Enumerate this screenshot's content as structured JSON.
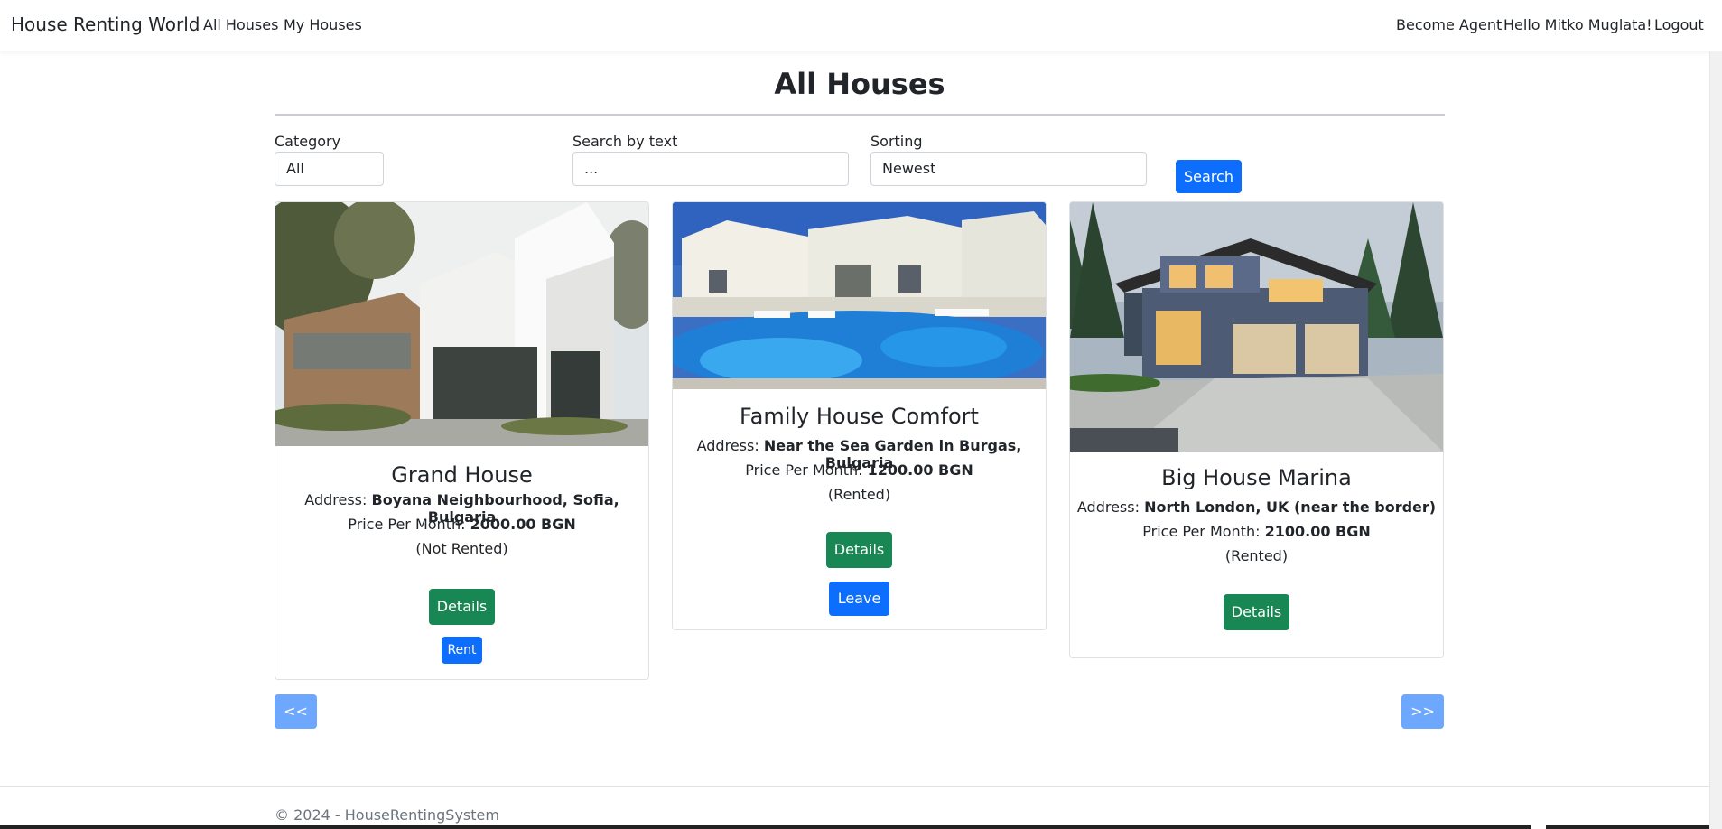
{
  "navbar": {
    "brand": "House Renting World",
    "links_left": [
      "All Houses",
      "My Houses"
    ],
    "links_right": [
      "Become Agent",
      "Hello Mitko Muglata!",
      "Logout"
    ]
  },
  "page": {
    "title": "All Houses"
  },
  "filters": {
    "category_label": "Category",
    "category_value": "All",
    "search_label": "Search by text",
    "search_placeholder": "...",
    "sorting_label": "Sorting",
    "sorting_value": "Newest",
    "search_button": "Search"
  },
  "houses": [
    {
      "title": "Grand House",
      "address_label": "Address: ",
      "address": "Boyana Neighbourhood, Sofia, Bulgaria",
      "price_label": "Price Per Month: ",
      "price": "2000.00 BGN",
      "status": "(Not Rented)",
      "details_button": "Details",
      "action_button": "Rent"
    },
    {
      "title": "Family House Comfort",
      "address_label": "Address: ",
      "address": "Near the Sea Garden in Burgas, Bulgaria",
      "price_label": "Price Per Month: ",
      "price": "1200.00 BGN",
      "status": "(Rented)",
      "details_button": "Details",
      "action_button": "Leave"
    },
    {
      "title": "Big House Marina",
      "address_label": "Address: ",
      "address": "North London, UK (near the border)",
      "price_label": "Price Per Month: ",
      "price": "2100.00 BGN",
      "status": "(Rented)",
      "details_button": "Details"
    }
  ],
  "pagination": {
    "prev": "<<",
    "next": ">>"
  },
  "footer": {
    "text": "© 2024 - HouseRentingSystem"
  },
  "colors": {
    "primary": "#0d6efd",
    "success": "#198754",
    "pager": "#6ea8fe"
  }
}
